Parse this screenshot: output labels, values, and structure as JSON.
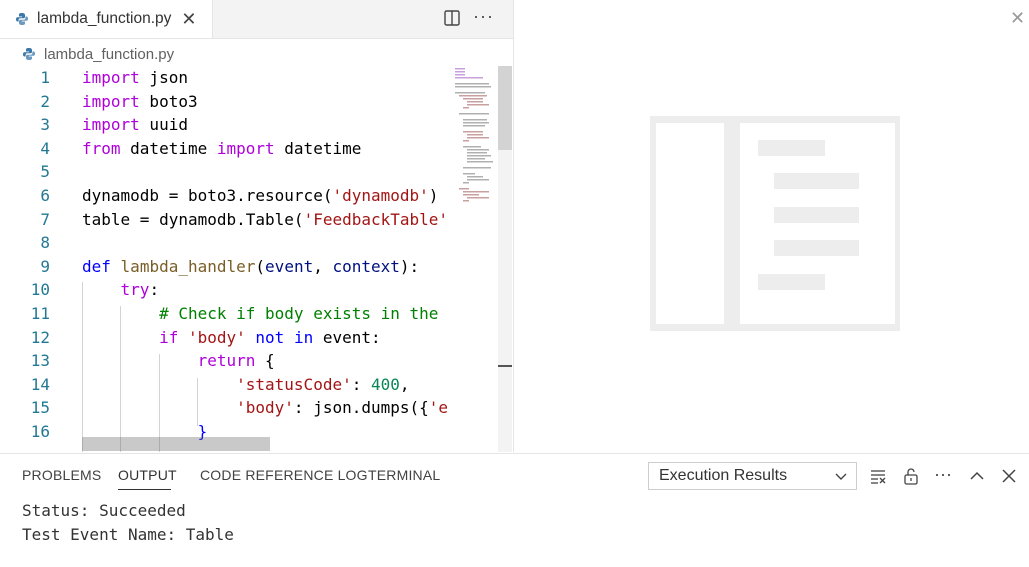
{
  "editor": {
    "tab": {
      "filename": "lambda_function.py"
    },
    "breadcrumb": {
      "filename": "lambda_function.py"
    },
    "lines": [
      {
        "num": "1",
        "tokens": [
          [
            "kw",
            "import"
          ],
          [
            "t",
            " json"
          ]
        ]
      },
      {
        "num": "2",
        "tokens": [
          [
            "kw",
            "import"
          ],
          [
            "t",
            " boto3"
          ]
        ]
      },
      {
        "num": "3",
        "tokens": [
          [
            "kw",
            "import"
          ],
          [
            "t",
            " uuid"
          ]
        ]
      },
      {
        "num": "4",
        "tokens": [
          [
            "kw",
            "from"
          ],
          [
            "t",
            " datetime "
          ],
          [
            "kw",
            "import"
          ],
          [
            "t",
            " datetime"
          ]
        ]
      },
      {
        "num": "5",
        "tokens": []
      },
      {
        "num": "6",
        "tokens": [
          [
            "t",
            "dynamodb = boto3.resource("
          ],
          [
            "str",
            "'dynamodb'"
          ],
          [
            "t",
            ")"
          ]
        ]
      },
      {
        "num": "7",
        "tokens": [
          [
            "t",
            "table = dynamodb.Table("
          ],
          [
            "str",
            "'FeedbackTable'"
          ]
        ]
      },
      {
        "num": "8",
        "tokens": []
      },
      {
        "num": "9",
        "tokens": [
          [
            "kb",
            "def"
          ],
          [
            "t",
            " "
          ],
          [
            "fn",
            "lambda_handler"
          ],
          [
            "t",
            "("
          ],
          [
            "var",
            "event"
          ],
          [
            "t",
            ", "
          ],
          [
            "var",
            "context"
          ],
          [
            "t",
            "):"
          ]
        ]
      },
      {
        "num": "10",
        "tokens": [
          [
            "t",
            "    "
          ],
          [
            "kw",
            "try"
          ],
          [
            "t",
            ":"
          ]
        ]
      },
      {
        "num": "11",
        "tokens": [
          [
            "t",
            "        "
          ],
          [
            "cm",
            "# Check if body exists in the"
          ]
        ]
      },
      {
        "num": "12",
        "tokens": [
          [
            "t",
            "        "
          ],
          [
            "kw",
            "if"
          ],
          [
            "t",
            " "
          ],
          [
            "str",
            "'body'"
          ],
          [
            "t",
            " "
          ],
          [
            "kb",
            "not"
          ],
          [
            "t",
            " "
          ],
          [
            "kb",
            "in"
          ],
          [
            "t",
            " event:"
          ]
        ]
      },
      {
        "num": "13",
        "tokens": [
          [
            "t",
            "            "
          ],
          [
            "kw",
            "return"
          ],
          [
            "t",
            " {"
          ]
        ]
      },
      {
        "num": "14",
        "tokens": [
          [
            "t",
            "                "
          ],
          [
            "str",
            "'statusCode'"
          ],
          [
            "t",
            ": "
          ],
          [
            "num",
            "400"
          ],
          [
            "t",
            ","
          ]
        ]
      },
      {
        "num": "15",
        "tokens": [
          [
            "t",
            "                "
          ],
          [
            "str",
            "'body'"
          ],
          [
            "t",
            ": json.dumps({"
          ],
          [
            "str",
            "'e"
          ]
        ]
      },
      {
        "num": "16",
        "tokens": [
          [
            "t",
            "            "
          ],
          [
            "kb",
            "}"
          ]
        ]
      }
    ]
  },
  "panel": {
    "tabs": [
      "PROBLEMS",
      "OUTPUT",
      "CODE REFERENCE LOG",
      "TERMINAL"
    ],
    "active_tab": "OUTPUT",
    "select_value": "Execution Results",
    "output_lines": [
      "Status: Succeeded",
      "Test Event Name: Table"
    ]
  },
  "icons": {
    "tab_file": "python-icon",
    "tab_close": "close-icon",
    "split_editor": "split-editor-icon",
    "more_actions": "more-icon",
    "right_close": "close-icon",
    "placeholder": "empty-editor-placeholder-icon",
    "clear_output": "clear-output-icon",
    "lock": "lock-icon",
    "panel_more": "more-icon",
    "maximize": "chevron-up-icon",
    "panel_close": "close-icon"
  },
  "colors": {
    "keyword": "#af00db",
    "keyword_blue": "#0000ff",
    "string": "#a31515",
    "number": "#098658",
    "comment": "#008000",
    "function": "#795e26",
    "line_number": "#237893"
  }
}
